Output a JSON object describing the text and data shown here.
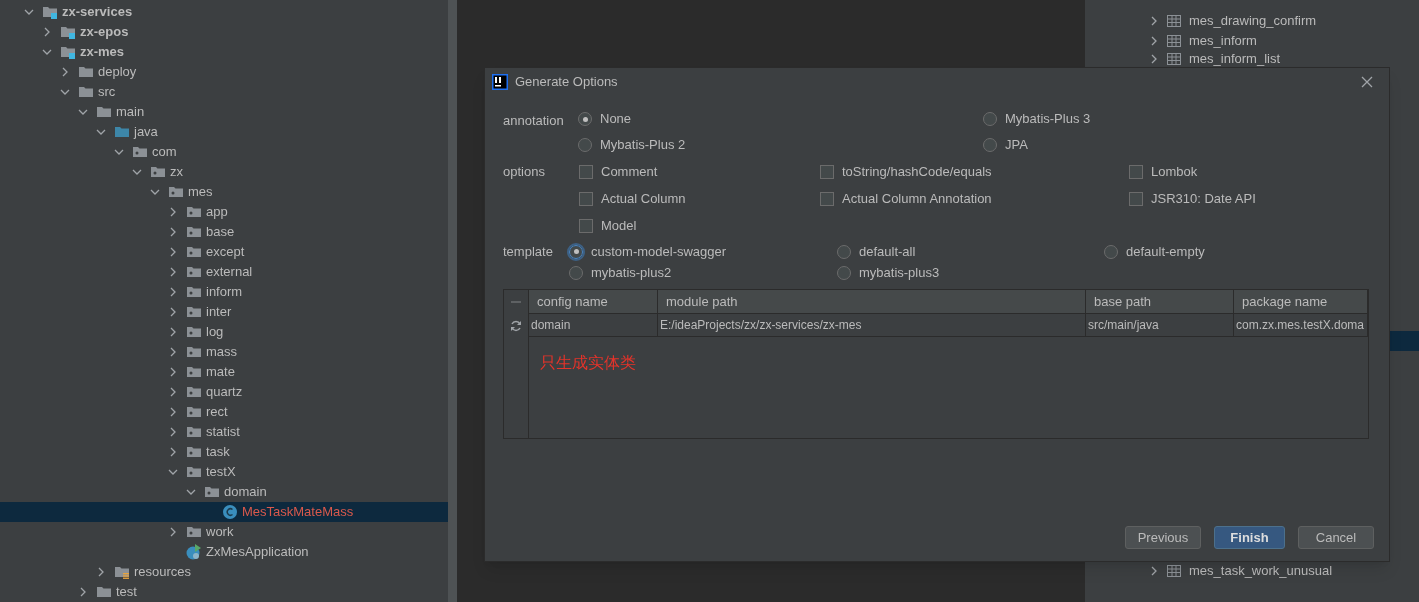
{
  "project_tree": [
    {
      "label": "zx-services",
      "kind": "module",
      "expanded": true,
      "selected": false,
      "children": [
        {
          "label": "zx-epos",
          "kind": "module",
          "expanded": false,
          "selected": false
        },
        {
          "label": "zx-mes",
          "kind": "module",
          "expanded": true,
          "selected": false,
          "children": [
            {
              "label": "deploy",
              "kind": "folder",
              "expanded": false,
              "selected": false
            },
            {
              "label": "src",
              "kind": "folder",
              "expanded": true,
              "selected": false,
              "children": [
                {
                  "label": "main",
                  "kind": "folder",
                  "expanded": true,
                  "selected": false,
                  "children": [
                    {
                      "label": "java",
                      "kind": "source",
                      "expanded": true,
                      "selected": false,
                      "children": [
                        {
                          "label": "com",
                          "kind": "package",
                          "expanded": true,
                          "selected": false,
                          "children": [
                            {
                              "label": "zx",
                              "kind": "package",
                              "expanded": true,
                              "selected": false,
                              "children": [
                                {
                                  "label": "mes",
                                  "kind": "package",
                                  "expanded": true,
                                  "selected": false,
                                  "children": [
                                    {
                                      "label": "app",
                                      "kind": "package",
                                      "expanded": false,
                                      "selected": false
                                    },
                                    {
                                      "label": "base",
                                      "kind": "package",
                                      "expanded": false,
                                      "selected": false
                                    },
                                    {
                                      "label": "except",
                                      "kind": "package",
                                      "expanded": false,
                                      "selected": false
                                    },
                                    {
                                      "label": "external",
                                      "kind": "package",
                                      "expanded": false,
                                      "selected": false
                                    },
                                    {
                                      "label": "inform",
                                      "kind": "package",
                                      "expanded": false,
                                      "selected": false
                                    },
                                    {
                                      "label": "inter",
                                      "kind": "package",
                                      "expanded": false,
                                      "selected": false
                                    },
                                    {
                                      "label": "log",
                                      "kind": "package",
                                      "expanded": false,
                                      "selected": false
                                    },
                                    {
                                      "label": "mass",
                                      "kind": "package",
                                      "expanded": false,
                                      "selected": false
                                    },
                                    {
                                      "label": "mate",
                                      "kind": "package",
                                      "expanded": false,
                                      "selected": false
                                    },
                                    {
                                      "label": "quartz",
                                      "kind": "package",
                                      "expanded": false,
                                      "selected": false
                                    },
                                    {
                                      "label": "rect",
                                      "kind": "package",
                                      "expanded": false,
                                      "selected": false
                                    },
                                    {
                                      "label": "statist",
                                      "kind": "package",
                                      "expanded": false,
                                      "selected": false
                                    },
                                    {
                                      "label": "task",
                                      "kind": "package",
                                      "expanded": false,
                                      "selected": false
                                    },
                                    {
                                      "label": "testX",
                                      "kind": "package",
                                      "expanded": true,
                                      "selected": false,
                                      "children": [
                                        {
                                          "label": "domain",
                                          "kind": "package",
                                          "expanded": true,
                                          "selected": false,
                                          "children": [
                                            {
                                              "label": "MesTaskMateMass",
                                              "kind": "class",
                                              "selected": true,
                                              "unversioned": true
                                            }
                                          ]
                                        }
                                      ]
                                    },
                                    {
                                      "label": "work",
                                      "kind": "package",
                                      "expanded": false,
                                      "selected": false
                                    },
                                    {
                                      "label": "ZxMesApplication",
                                      "kind": "app",
                                      "selected": false
                                    }
                                  ]
                                }
                              ]
                            }
                          ]
                        }
                      ]
                    },
                    {
                      "label": "resources",
                      "kind": "resources",
                      "expanded": false,
                      "selected": false
                    }
                  ]
                },
                {
                  "label": "test",
                  "kind": "folder",
                  "expanded": false,
                  "selected": false
                }
              ]
            }
          ]
        }
      ]
    }
  ],
  "database_tree": {
    "top": [
      {
        "label": "mes_drawing_confirm",
        "expanded": false
      },
      {
        "label": "mes_inform",
        "expanded": false
      },
      {
        "label": "mes_inform_list",
        "expanded": false
      }
    ],
    "bottom": [
      {
        "label": "mes_task_work_unusual",
        "expanded": false
      }
    ]
  },
  "dialog": {
    "title": "Generate Options",
    "annotation": {
      "label": "annotation",
      "options": [
        {
          "label": "None",
          "selected": true
        },
        {
          "label": "Mybatis-Plus 3",
          "selected": false
        },
        {
          "label": "Mybatis-Plus 2",
          "selected": false
        },
        {
          "label": "JPA",
          "selected": false
        }
      ]
    },
    "options": {
      "label": "options",
      "items": [
        {
          "label": "Comment",
          "checked": false
        },
        {
          "label": "toString/hashCode/equals",
          "checked": false
        },
        {
          "label": "Lombok",
          "checked": false
        },
        {
          "label": "Actual Column",
          "checked": false
        },
        {
          "label": "Actual Column Annotation",
          "checked": false
        },
        {
          "label": "JSR310: Date API",
          "checked": false
        },
        {
          "label": "Model",
          "checked": false
        }
      ]
    },
    "template": {
      "label": "template",
      "options": [
        {
          "label": "custom-model-swagger",
          "selected": true,
          "focused": true
        },
        {
          "label": "default-all",
          "selected": false,
          "focused": false
        },
        {
          "label": "default-empty",
          "selected": false,
          "focused": false
        },
        {
          "label": "mybatis-plus2",
          "selected": false,
          "focused": false
        },
        {
          "label": "mybatis-plus3",
          "selected": false,
          "focused": false
        }
      ]
    },
    "table": {
      "columns": [
        "config name",
        "module path",
        "base path",
        "package name"
      ],
      "rows": [
        [
          "domain",
          "E:/ideaProjects/zx/zx-services/zx-mes",
          "src/main/java",
          "com.zx.mes.testX.doma"
        ]
      ]
    },
    "note": "只生成实体类",
    "buttons": [
      {
        "label": "Previous",
        "kind": "secondary"
      },
      {
        "label": "Finish",
        "kind": "primary"
      },
      {
        "label": "Cancel",
        "kind": "secondary"
      }
    ]
  }
}
